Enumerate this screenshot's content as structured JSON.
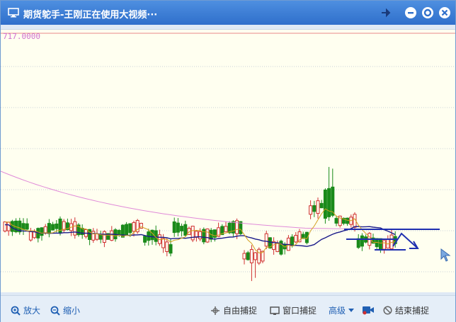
{
  "window": {
    "title": "期货鸵手-王刚正在使用大视频···",
    "controls": [
      "pin-icon",
      "minimize-icon",
      "settings-icon",
      "close-icon"
    ]
  },
  "chart": {
    "price_label": "717.0000",
    "colors": {
      "up_candle": "#d03030",
      "down_candle": "#1a8a1a",
      "ma_short": "#d4a020",
      "ma_mid": "#1a1a8a",
      "ma_long": "#e08ad8",
      "annotation": "#1f2fb0",
      "grid": "#c8d0d8"
    }
  },
  "chart_data": {
    "type": "candlestick",
    "top_price_label": "717.0000",
    "series": [
      {
        "color": "#e08ad8"
      },
      {
        "color": "#1a1a8a"
      },
      {
        "color": "#d4a020"
      }
    ]
  },
  "toolbar": {
    "zoom_in_label": "放大",
    "zoom_out_label": "缩小",
    "free_capture_label": "自由捕捉",
    "window_capture_label": "窗口捕捉",
    "advanced_label": "高级",
    "end_capture_label": "结束捕捉"
  }
}
